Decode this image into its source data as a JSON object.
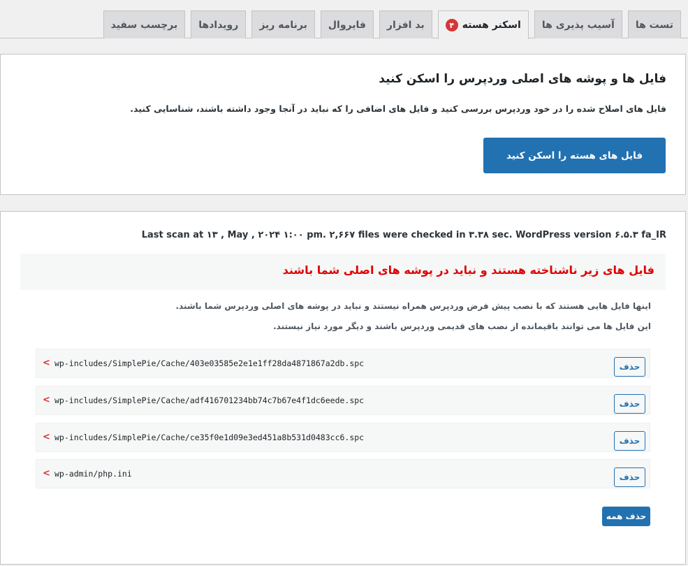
{
  "tabs": [
    {
      "label": "تست ها"
    },
    {
      "label": "آسیب پذیری ها"
    },
    {
      "label": "اسکنر هسته",
      "badge": "۴",
      "active": true
    },
    {
      "label": "بد افزار"
    },
    {
      "label": "فایروال"
    },
    {
      "label": "برنامه ریز"
    },
    {
      "label": "رویدادها"
    },
    {
      "label": "برچسب سفید"
    }
  ],
  "scan_card": {
    "title": "فایل ها و پوشه های اصلی وردپرس را اسکن کنید",
    "description": "فایل های اصلاح شده را در خود وردپرس بررسی کنید و فایل های اضافی را که نباید در آنجا وجود داشته باشند، شناسایی کنید.",
    "button_label": "فایل های هسته را اسکن کنید"
  },
  "results": {
    "last_scan": "Last scan at ۱۳ , May , ۲۰۲۴ ۱:۰۰ pm. ۲,۶۶۷ files were checked in ۳.۳۸ sec. WordPress version ۶.۵.۳ fa_IR",
    "alert_title": "فایل های زیر ناشناخته هستند و نباید در پوشه های اصلی شما باشند",
    "info_line1": "اینها فایل هایی هستند که با نصب پیش فرض وردپرس همراه نیستند و نباید در پوشه های اصلی وردپرس شما باشند.",
    "info_line2": "این فایل ها می توانند باقیمانده از نصب های قدیمی وردپرس باشند و دیگر مورد نیاز نیستند.",
    "files": [
      {
        "path": "wp-includes/SimplePie/Cache/403e03585e2e1e1ff28da4871867a2db.spc",
        "delete_label": "حذف"
      },
      {
        "path": "wp-includes/SimplePie/Cache/adf416701234bb74c7b67e4f1dc6eede.spc",
        "delete_label": "حذف"
      },
      {
        "path": "wp-includes/SimplePie/Cache/ce35f0e1d09e3ed451a8b531d0483cc6.spc",
        "delete_label": "حذف"
      },
      {
        "path": "wp-admin/php.ini",
        "delete_label": "حذف"
      }
    ],
    "chevron": "<",
    "delete_all_label": "حذف همه"
  },
  "colors": {
    "accent": "#2271b1",
    "alert": "#e00000",
    "badge": "#d63638"
  }
}
